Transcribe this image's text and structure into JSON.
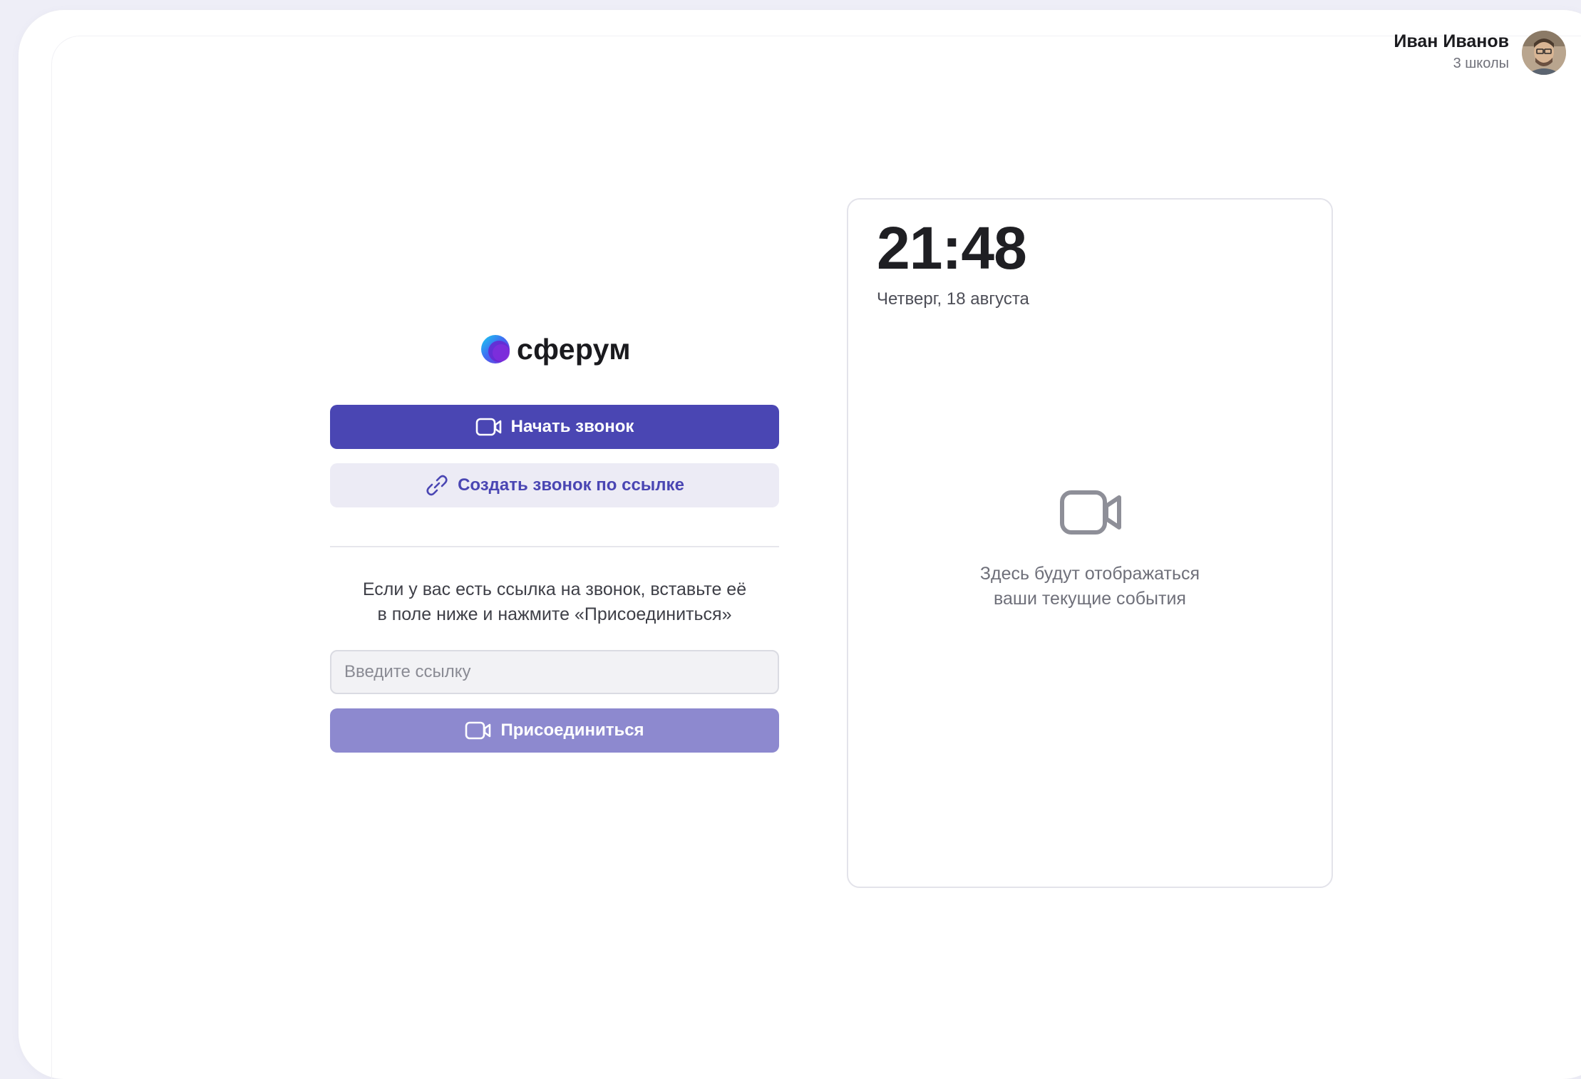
{
  "user": {
    "name": "Иван Иванов",
    "subtitle": "3 школы"
  },
  "logo": {
    "text": "сферум"
  },
  "actions": {
    "start_call_label": "Начать звонок",
    "create_link_call_label": "Создать звонок по ссылке"
  },
  "join": {
    "hint_line1": "Если у вас есть ссылка на звонок, вставьте её",
    "hint_line2": "в поле ниже и нажмите «Присоединиться»",
    "input_placeholder": "Введите ссылку",
    "input_value": "",
    "join_label": "Присоединиться"
  },
  "events": {
    "time": "21:48",
    "date": "Четверг, 18 августа",
    "empty_line1": "Здесь будут отображаться",
    "empty_line2": "ваши текущие события"
  },
  "icons": {
    "start_call": "video-camera-icon",
    "create_link": "link-icon",
    "join": "video-camera-icon",
    "empty_events": "video-camera-icon",
    "menu": "chevron-down-icon"
  },
  "colors": {
    "primary": "#4a46b3",
    "primary_disabled": "#8d89cf",
    "secondary_bg": "#ecebf5",
    "background": "#eeeef7"
  }
}
